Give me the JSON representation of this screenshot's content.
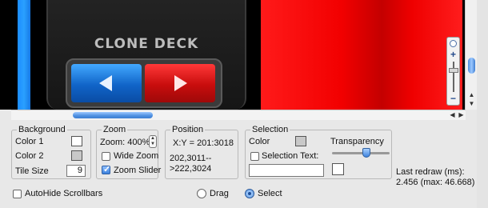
{
  "canvas": {
    "deck_label": "CLONE DECK"
  },
  "background": {
    "title": "Background",
    "color1_label": "Color 1",
    "color1_value": "#ffffff",
    "color2_label": "Color 2",
    "color2_value": "#c8c8c8",
    "tile_size_label": "Tile Size",
    "tile_size_value": "9"
  },
  "zoom": {
    "title": "Zoom",
    "zoom_label": "Zoom: 400%",
    "wide_zoom_label": "Wide Zoom",
    "wide_zoom_checked": false,
    "zoom_slider_label": "Zoom Slider",
    "zoom_slider_checked": true
  },
  "position": {
    "title": "Position",
    "xy_text": "X:Y = 201:3018",
    "range_line1": "202,3011--",
    "range_line2": ">222,3024"
  },
  "selection": {
    "title": "Selection",
    "color_label": "Color",
    "color_value": "#c8c8c8",
    "transparency_label": "Transparency",
    "transparency_value": 0.6,
    "selection_text_label": "Selection Text:",
    "selection_text_checked": false,
    "selection_text_value": ""
  },
  "status": {
    "last_redraw_line1": "Last redraw (ms):",
    "last_redraw_line2": "2.456 (max: 46.668)"
  },
  "bottom": {
    "autohide_label": "AutoHide Scrollbars",
    "autohide_checked": false,
    "mode_drag_label": "Drag",
    "mode_select_label": "Select",
    "mode_selected": "Select"
  },
  "colors": {
    "blue_accent": "#1b8dff",
    "red_panel": "#f20000",
    "deck_background": "#1c1c1c"
  }
}
